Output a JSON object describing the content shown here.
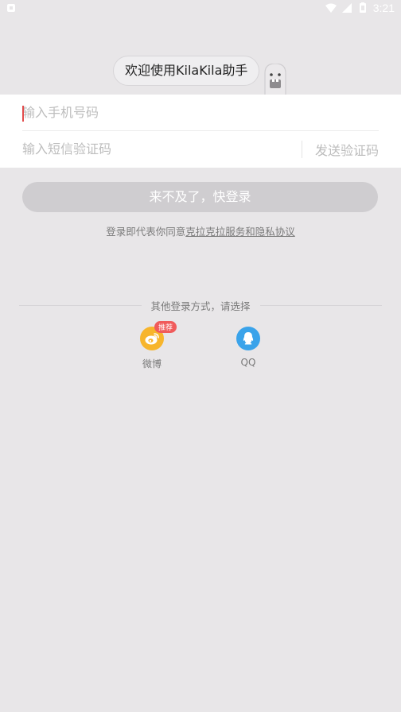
{
  "status_bar": {
    "time": "3:21"
  },
  "welcome": {
    "text": "欢迎使用KilaKila助手"
  },
  "form": {
    "phone_placeholder": "输入手机号码",
    "sms_placeholder": "输入短信验证码",
    "send_code_label": "发送验证码"
  },
  "login_button": {
    "label": "来不及了，快登录"
  },
  "agreement": {
    "prefix": "登录即代表你同意",
    "link": "克拉克拉服务和隐私协议"
  },
  "other_login": {
    "title": "其他登录方式，请选择",
    "options": [
      {
        "label": "微博",
        "icon": "weibo-icon",
        "badge": "推荐",
        "color": "#f7b52c"
      },
      {
        "label": "QQ",
        "icon": "qq-icon",
        "color": "#3aa3ea"
      }
    ]
  }
}
